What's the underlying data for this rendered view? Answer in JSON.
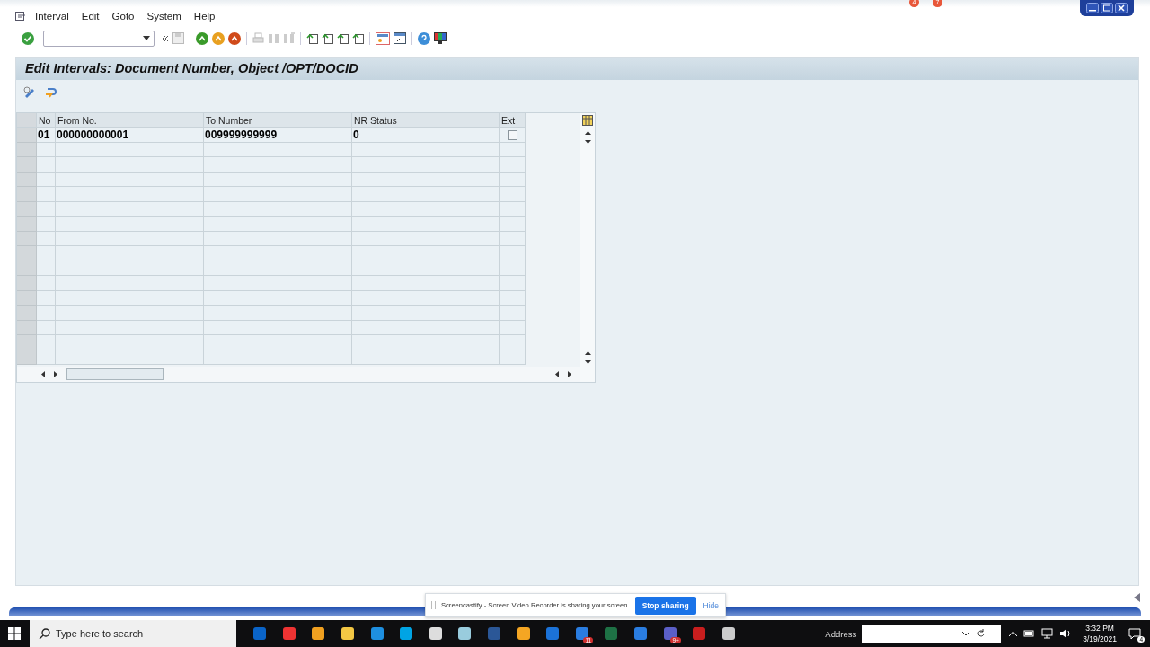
{
  "menu": [
    {
      "label": "Interval"
    },
    {
      "label": "Edit"
    },
    {
      "label": "Goto"
    },
    {
      "label": "System"
    },
    {
      "label": "Help"
    }
  ],
  "top_badges": [
    "4",
    "7"
  ],
  "screen_title": "Edit Intervals: Document Number, Object /OPT/DOCID",
  "table": {
    "columns": [
      "No",
      "From No.",
      "To Number",
      "NR Status",
      "Ext"
    ],
    "rows": [
      {
        "no": "01",
        "from": "000000000001",
        "to": "009999999999",
        "status": "0",
        "ext": false
      }
    ]
  },
  "notification": {
    "text": "Screencastify - Screen Video Recorder is sharing your screen.",
    "buttons": [
      "Stop sharing",
      "Hide"
    ]
  },
  "taskbar": {
    "search_placeholder": "Type here to search",
    "badges": [
      "11",
      "9+"
    ],
    "address_label": "Address",
    "time": "3:32 PM",
    "date": "3/19/2021",
    "notification_count": "4"
  }
}
